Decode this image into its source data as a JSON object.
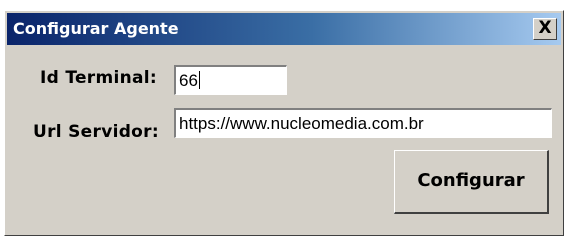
{
  "window": {
    "title": "Configurar Agente",
    "close_label": "X"
  },
  "form": {
    "terminal_label": "Id Terminal:",
    "terminal_value": "66",
    "server_label": "Url Servidor:",
    "server_value": "https://www.nucleomedia.com.br",
    "submit_label": "Configurar"
  },
  "colors": {
    "titlebar_start": "#0a246a",
    "titlebar_end": "#a6caf0",
    "face": "#d4d0c8"
  }
}
